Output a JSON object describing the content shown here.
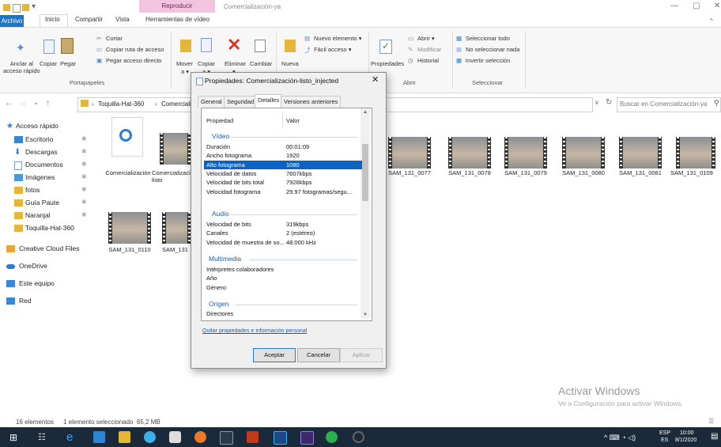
{
  "window": {
    "title": "Comercialización-ya",
    "context_tab": "Reproducir"
  },
  "ribbon": {
    "tabs": [
      "Archivo",
      "Inicio",
      "Compartir",
      "Vista",
      "Herramientas de vídeo"
    ],
    "portapapeles": {
      "anclar": "Anclar al\nacceso rápido",
      "copiar": "Copiar",
      "pegar": "Pegar",
      "cortar": "Cortar",
      "copiar_ruta": "Copiar ruta de acceso",
      "pegar_acceso": "Pegar acceso directo",
      "group": "Portapapeles"
    },
    "organizar": {
      "mover": "Mover",
      "copiar": "Copiar",
      "eliminar": "Eliminar",
      "cambiar": "Cambiar",
      "nombre": "nombre",
      "mover2": "a ▾",
      "copiar2": "a ▾",
      "eliminar2": "▾"
    },
    "nuevo": {
      "nueva": "Nueva",
      "carpeta": "carpeta",
      "nuevo_elemento": "Nuevo elemento ▾",
      "facil_acceso": "Fácil acceso ▾"
    },
    "abrir": {
      "propiedades": "Propiedades",
      "abrir": "Abrir ▾",
      "modificar": "Modificar",
      "historial": "Historial",
      "group": "Abrir"
    },
    "seleccionar": {
      "todo": "Seleccionar todo",
      "nada": "No seleccionar nada",
      "invertir": "Invertir selección",
      "group": "Seleccionar"
    }
  },
  "address": {
    "path": [
      "Toquilla-Hat-360",
      "Comercialización"
    ],
    "search_placeholder": "Buscar en Comercialización-ya"
  },
  "nav": {
    "quick_access": "Acceso rápido",
    "items": [
      "Escritorio",
      "Descargas",
      "Documentos",
      "Imágenes",
      "fotos",
      "Guía Paute",
      "Naranjal",
      "Toquilla-Hat-360"
    ],
    "creative_cloud": "Creative Cloud Files",
    "onedrive": "OneDrive",
    "este_equipo": "Este equipo",
    "red": "Red"
  },
  "files": {
    "row1": [
      "Comercialización",
      "Comercialización-listo",
      "SAM_131_0077",
      "SAM_131_0078",
      "SAM_131_0079",
      "SAM_131_0080",
      "SAM_131_0081",
      "SAM_131_0109"
    ],
    "row2": [
      "SAM_131_0110",
      "SAM_131"
    ]
  },
  "status": {
    "count": "16 elementos",
    "selection": "1 elemento seleccionado  65,2 MB"
  },
  "watermark": {
    "title": "Activar Windows",
    "subtitle": "Ve a Configuración para activar Windows."
  },
  "taskbar": {
    "lang1": "ESP",
    "lang2": "ES",
    "time": "10:00",
    "date": "8/1/2020"
  },
  "dialog": {
    "title": "Propiedades: Comercialización-listo_injected",
    "tabs": [
      "General",
      "Seguridad",
      "Detalles",
      "Versiones anteriores"
    ],
    "header_prop": "Propiedad",
    "header_val": "Valor",
    "sections": {
      "video": "Vídeo",
      "audio": "Audio",
      "multimedia": "Multimedia",
      "origen": "Origen"
    },
    "video_rows": [
      {
        "name": "Duración",
        "value": "00:01:09"
      },
      {
        "name": "Ancho fotograma",
        "value": "1920"
      },
      {
        "name": "Alto fotograma",
        "value": "1080"
      },
      {
        "name": "Velocidad de datos",
        "value": "7607kbps"
      },
      {
        "name": "Velocidad de bits total",
        "value": "7926kbps"
      },
      {
        "name": "Velocidad fotograma",
        "value": "29.97 fotogramas/segu..."
      }
    ],
    "audio_rows": [
      {
        "name": "Velocidad de bits",
        "value": "319kbps"
      },
      {
        "name": "Canales",
        "value": "2 (estéreo)"
      },
      {
        "name": "Velocidad de muestra de so...",
        "value": "48.000 kHz"
      }
    ],
    "multimedia_rows": [
      {
        "name": "Intérpretes colaboradores",
        "value": ""
      },
      {
        "name": "Año",
        "value": ""
      },
      {
        "name": "Género",
        "value": ""
      }
    ],
    "origen_rows": [
      {
        "name": "Directores",
        "value": ""
      }
    ],
    "selected_row": "Alto fotograma",
    "remove_link": "Quitar propiedades e información personal",
    "buttons": {
      "ok": "Aceptar",
      "cancel": "Cancelar",
      "apply": "Aplicar"
    }
  }
}
